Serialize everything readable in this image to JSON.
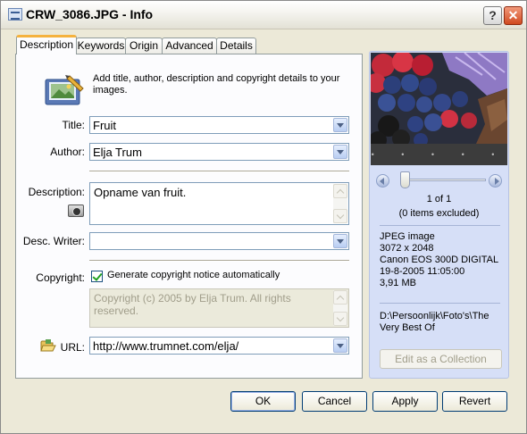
{
  "window": {
    "title": "CRW_3086.JPG - Info",
    "help_glyph": "?",
    "close_glyph": "✕"
  },
  "tabs": [
    "Description",
    "Keywords",
    "Origin",
    "Advanced",
    "Details"
  ],
  "active_tab": "Description",
  "intro": "Add title, author, description and copyright details to your images.",
  "fields": {
    "title": {
      "label": "Title:",
      "value": "Fruit"
    },
    "author": {
      "label": "Author:",
      "value": "Elja Trum"
    },
    "description": {
      "label": "Description:",
      "value": "Opname van fruit."
    },
    "desc_writer": {
      "label": "Desc. Writer:",
      "value": ""
    },
    "copyright": {
      "label": "Copyright:",
      "checkbox_label": "Generate copyright notice automatically",
      "checked": true,
      "value": "Copyright (c) 2005 by Elja Trum. All rights reserved."
    },
    "url": {
      "label": "URL:",
      "value": "http://www.trumnet.com/elja/"
    }
  },
  "preview": {
    "counter": "1 of 1",
    "excluded": "(0 items excluded)",
    "info": [
      "JPEG image",
      "3072 x 2048",
      "Canon EOS 300D DIGITAL",
      "19-8-2005 11:05:00",
      "3,91 MB"
    ],
    "path": "D:\\Persoonlijk\\Foto's\\The Very Best Of",
    "dots": "• • • • •",
    "collection_button": "Edit as a Collection"
  },
  "buttons": {
    "ok": "OK",
    "cancel": "Cancel",
    "apply": "Apply",
    "revert": "Revert"
  },
  "colors": {
    "dialog_bg": "#ece9d8",
    "panel_bg": "#fcfcfe",
    "preview_bg": "#d6dff7",
    "active_tab_accent": "#f5b23e",
    "field_border": "#7f9db9"
  }
}
